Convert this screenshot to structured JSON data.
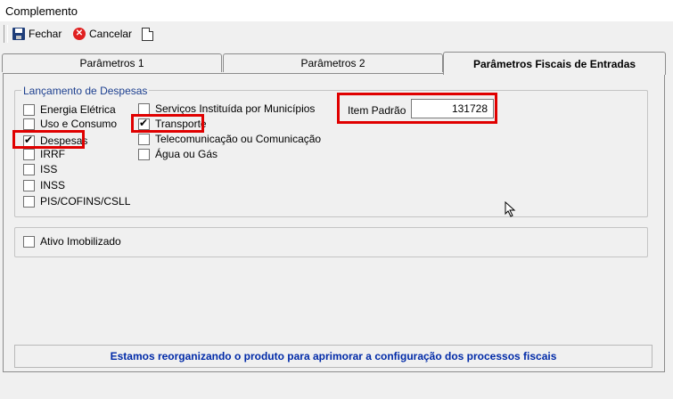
{
  "window": {
    "title": "Complemento"
  },
  "toolbar": {
    "fechar_label": "Fechar",
    "cancelar_label": "Cancelar"
  },
  "tabs": [
    {
      "label": "Parâmetros 1",
      "active": false
    },
    {
      "label": "Parâmetros 2",
      "active": false
    },
    {
      "label": "Parâmetros Fiscais de Entradas",
      "active": true
    }
  ],
  "lancamento": {
    "title": "Lançamento de Despesas",
    "col1": [
      {
        "label": "Energia Elétrica",
        "checked": false
      },
      {
        "label": "Uso e Consumo",
        "checked": false
      },
      {
        "label": "Despesas",
        "checked": true
      },
      {
        "label": "IRRF",
        "checked": false
      },
      {
        "label": "ISS",
        "checked": false
      },
      {
        "label": "INSS",
        "checked": false
      },
      {
        "label": "PIS/COFINS/CSLL",
        "checked": false
      }
    ],
    "col2": [
      {
        "label": "Serviços Instituída por Municípios",
        "checked": false
      },
      {
        "label": "Transporte",
        "checked": true
      },
      {
        "label": "Telecomunicação ou Comunicação",
        "checked": false
      },
      {
        "label": "Água ou Gás",
        "checked": false
      }
    ],
    "item_padrao": {
      "label": "Item Padrão",
      "value": "131728"
    }
  },
  "ativo": {
    "label": "Ativo Imobilizado",
    "checked": false
  },
  "message": "Estamos reorganizando o produto para aprimorar a configuração dos processos fiscais",
  "colors": {
    "highlight": "#e00000",
    "group_title": "#1c3f8f",
    "message": "#002aa8"
  }
}
